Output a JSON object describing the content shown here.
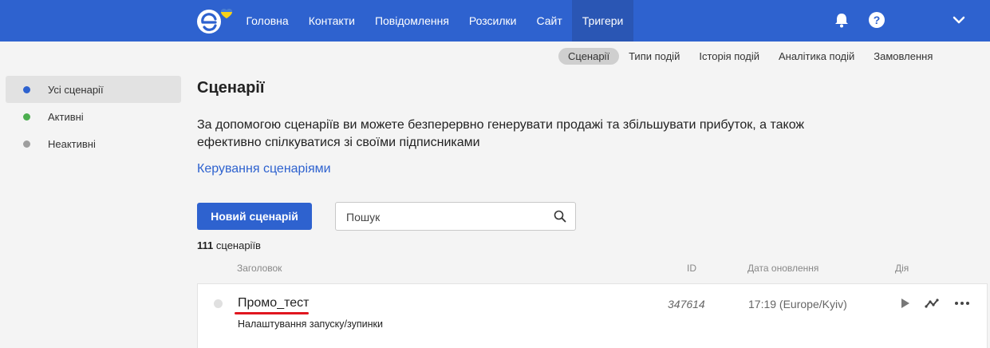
{
  "nav": {
    "items": [
      {
        "label": "Головна",
        "active": false
      },
      {
        "label": "Контакти",
        "active": false
      },
      {
        "label": "Повідомлення",
        "active": false
      },
      {
        "label": "Розсилки",
        "active": false
      },
      {
        "label": "Сайт",
        "active": false
      },
      {
        "label": "Тригери",
        "active": true
      }
    ],
    "icons": [
      "bell-icon",
      "help-icon",
      "chevron-down-icon"
    ]
  },
  "subnav": {
    "items": [
      {
        "label": "Сценарії",
        "active": true
      },
      {
        "label": "Типи подій",
        "active": false
      },
      {
        "label": "Історія подій",
        "active": false
      },
      {
        "label": "Аналітика подій",
        "active": false
      },
      {
        "label": "Замовлення",
        "active": false
      }
    ]
  },
  "sidebar": {
    "items": [
      {
        "label": "Усі сценарії",
        "color": "#2e62cf",
        "active": true
      },
      {
        "label": "Активні",
        "color": "#4cae4f",
        "active": false
      },
      {
        "label": "Неактивні",
        "color": "#9e9e9e",
        "active": false
      }
    ]
  },
  "main": {
    "title": "Сценарії",
    "description": "За допомогою сценаріїв ви можете безперервно генерувати продажі та збільшувати прибуток, а також ефективно спілкуватися зі своїми підписниками",
    "manage_link": "Керування сценаріями",
    "new_button": "Новий сценарій",
    "search_placeholder": "Пошук",
    "search_value": "",
    "count_number": "111",
    "count_label": "сценаріїв"
  },
  "table": {
    "headers": {
      "title": "Заголовок",
      "id": "ID",
      "date": "Дата оновлення",
      "action": "Дія"
    },
    "rows": [
      {
        "title": "Промо_тест",
        "subtitle": "Налаштування запуску/зупинки",
        "id": "347614",
        "date": "17:19 (Europe/Kyiv)",
        "status": "inactive"
      }
    ]
  },
  "colors": {
    "brand": "#2e62cf",
    "annotation": "#e0161f"
  }
}
